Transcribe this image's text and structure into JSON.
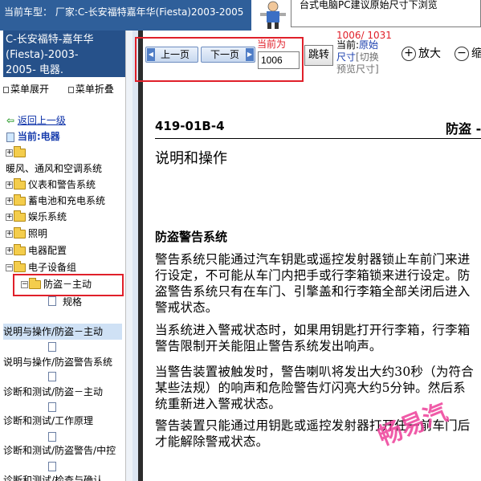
{
  "top": {
    "vehicle_label": "当前车型：  厂家:C-长安福特嘉年华(Fiesta)2003-2005",
    "tip": "台式电脑PC建议原始尺寸下浏览"
  },
  "left": {
    "vehicle_line1": "C-长安福特-嘉年华",
    "vehicle_line2": "(Fiesta)-2003-",
    "vehicle_line3": "2005- 电器.",
    "menu_expand": "菜单展开",
    "menu_collapse": "菜单折叠",
    "back_link": "返回上一级",
    "current": "当前:电器",
    "tree": [
      {
        "label": ""
      },
      {
        "label": "暖风、通风和空调系统"
      },
      {
        "label": "仪表和警告系统"
      },
      {
        "label": "蓄电池和充电系统"
      },
      {
        "label": "娱乐系统"
      },
      {
        "label": "照明"
      },
      {
        "label": "电器配置"
      },
      {
        "label": "电子设备组"
      },
      {
        "label": "防盗－主动"
      },
      {
        "label": "规格"
      },
      {
        "label": "说明与操作/防盗－主动"
      },
      {
        "label": "说明与操作/防盗警告系统"
      },
      {
        "label": "诊断和测试/防盗－主动"
      },
      {
        "label": "诊断和测试/工作原理"
      },
      {
        "label": "诊断和测试/防盗警告/中控"
      },
      {
        "label": "诊断和测试/检查与确认"
      }
    ]
  },
  "toolbar": {
    "prev_label": "上一页",
    "next_label": "下一页",
    "current_label": "当前为",
    "page_value": "1006",
    "jump_label": "跳转",
    "page_count": "1006/ 1031",
    "size_current": "当前:",
    "size_mode": "原始尺寸",
    "size_toggle": "[切换预览尺寸]",
    "zoom_in": "放大",
    "zoom_out": "缩"
  },
  "document": {
    "code": "419-01B-4",
    "head_right": "防盗 -",
    "title": "说明和操作",
    "section": "防盗警告系统",
    "paragraphs": [
      "警告系统只能通过汽车钥匙或遥控发射器锁止车前门来进行设定，不可能从车门内把手或行李箱锁来进行设定。防盗警告系统只有在车门、引擎盖和行李箱全部关闭后进入警戒状态。",
      "当系统进入警戒状态时，如果用钥匙打开行李箱，行李箱警告限制开关能阻止警告系统发出响声。",
      "当警告装置被触发时，警告喇叭将发出大约30秒（为符合某些法规）的响声和危险警告灯闪亮大约5分钟。然后系统重新进入警戒状态。",
      "警告装置只能通过用钥匙或遥控发射器打开任一前车门后才能解除警戒状态。"
    ],
    "watermark": "畅易汽"
  },
  "colors": {
    "highlight": "#e0202a",
    "header_blue": "#26518a",
    "watermark_pink": "#ee3f9a"
  }
}
